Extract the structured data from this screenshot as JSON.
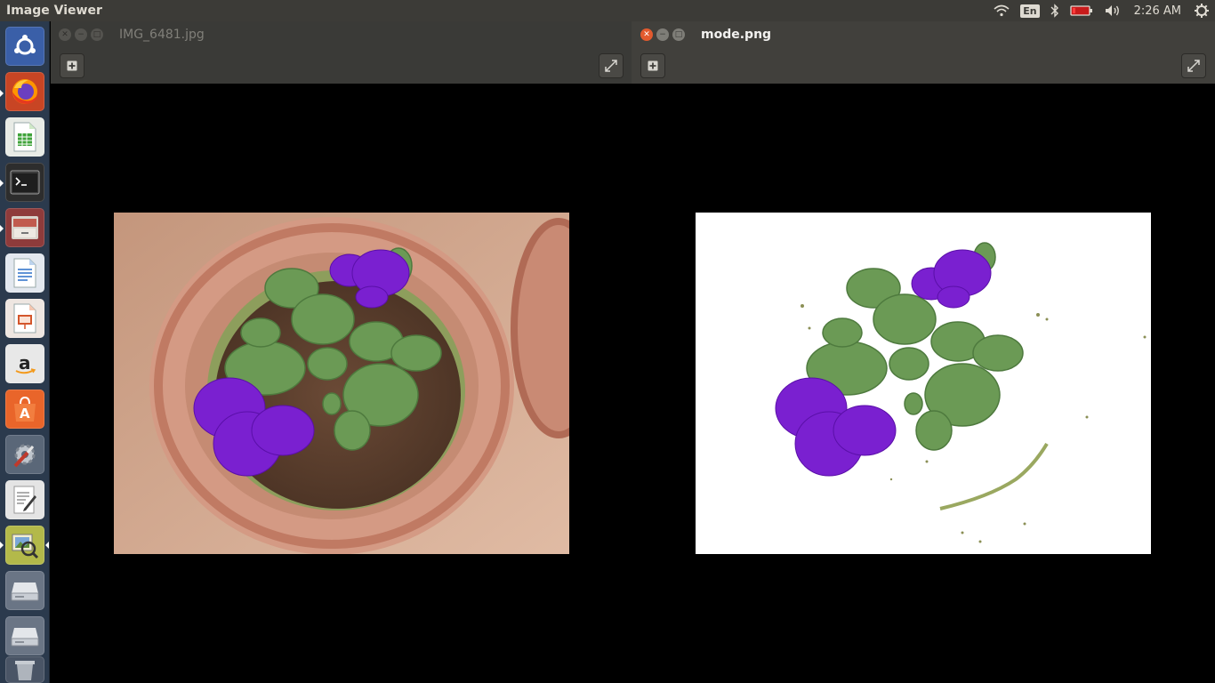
{
  "top_panel": {
    "app_title": "Image Viewer",
    "keyboard_layout": "En",
    "clock": "2:26 AM",
    "icons": [
      "wifi-icon",
      "keyboard-layout-icon",
      "bluetooth-icon",
      "battery-icon",
      "volume-icon",
      "system-gear-icon"
    ]
  },
  "launcher": {
    "items": [
      "ubuntu-dash",
      "firefox",
      "libreoffice-calc",
      "terminal",
      "file-manager",
      "libreoffice-writer",
      "libreoffice-impress",
      "amazon",
      "ubuntu-software",
      "system-settings",
      "text-editor",
      "image-viewer",
      "drive",
      "drive",
      "trash"
    ]
  },
  "windows": {
    "left": {
      "title": "IMG_6481.jpg",
      "active": false
    },
    "right": {
      "title": "mode.png",
      "active": true
    }
  },
  "colors": {
    "panel": "#3c3b37",
    "launcher": "#2b3a4d",
    "close_active": "#e35a2e",
    "flower_purple": "#8a16d6",
    "leaf_green": "#6b9a55"
  }
}
